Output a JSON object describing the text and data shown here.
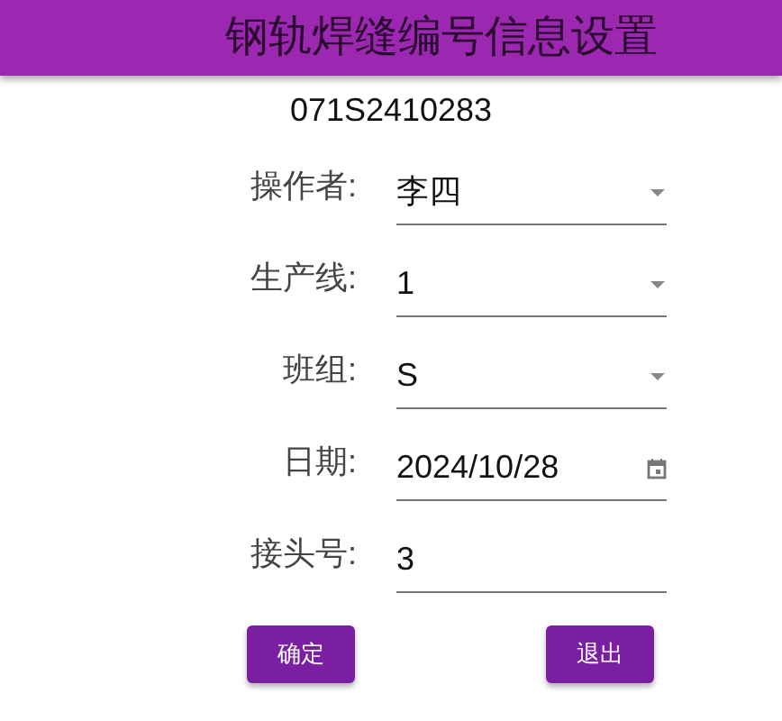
{
  "window": {
    "title": "钢轨焊缝编号信息设置"
  },
  "serial": "071S2410283",
  "fields": [
    {
      "label": "操作者:",
      "value": "李四",
      "kind": "select"
    },
    {
      "label": "生产线:",
      "value": "1",
      "kind": "select"
    },
    {
      "label": "班组:",
      "value": "S",
      "kind": "select"
    },
    {
      "label": "日期:",
      "value": "2024/10/28",
      "kind": "date"
    },
    {
      "label": "接头号:",
      "value": "3",
      "kind": "text"
    }
  ],
  "buttons": [
    "确定",
    "退出"
  ]
}
